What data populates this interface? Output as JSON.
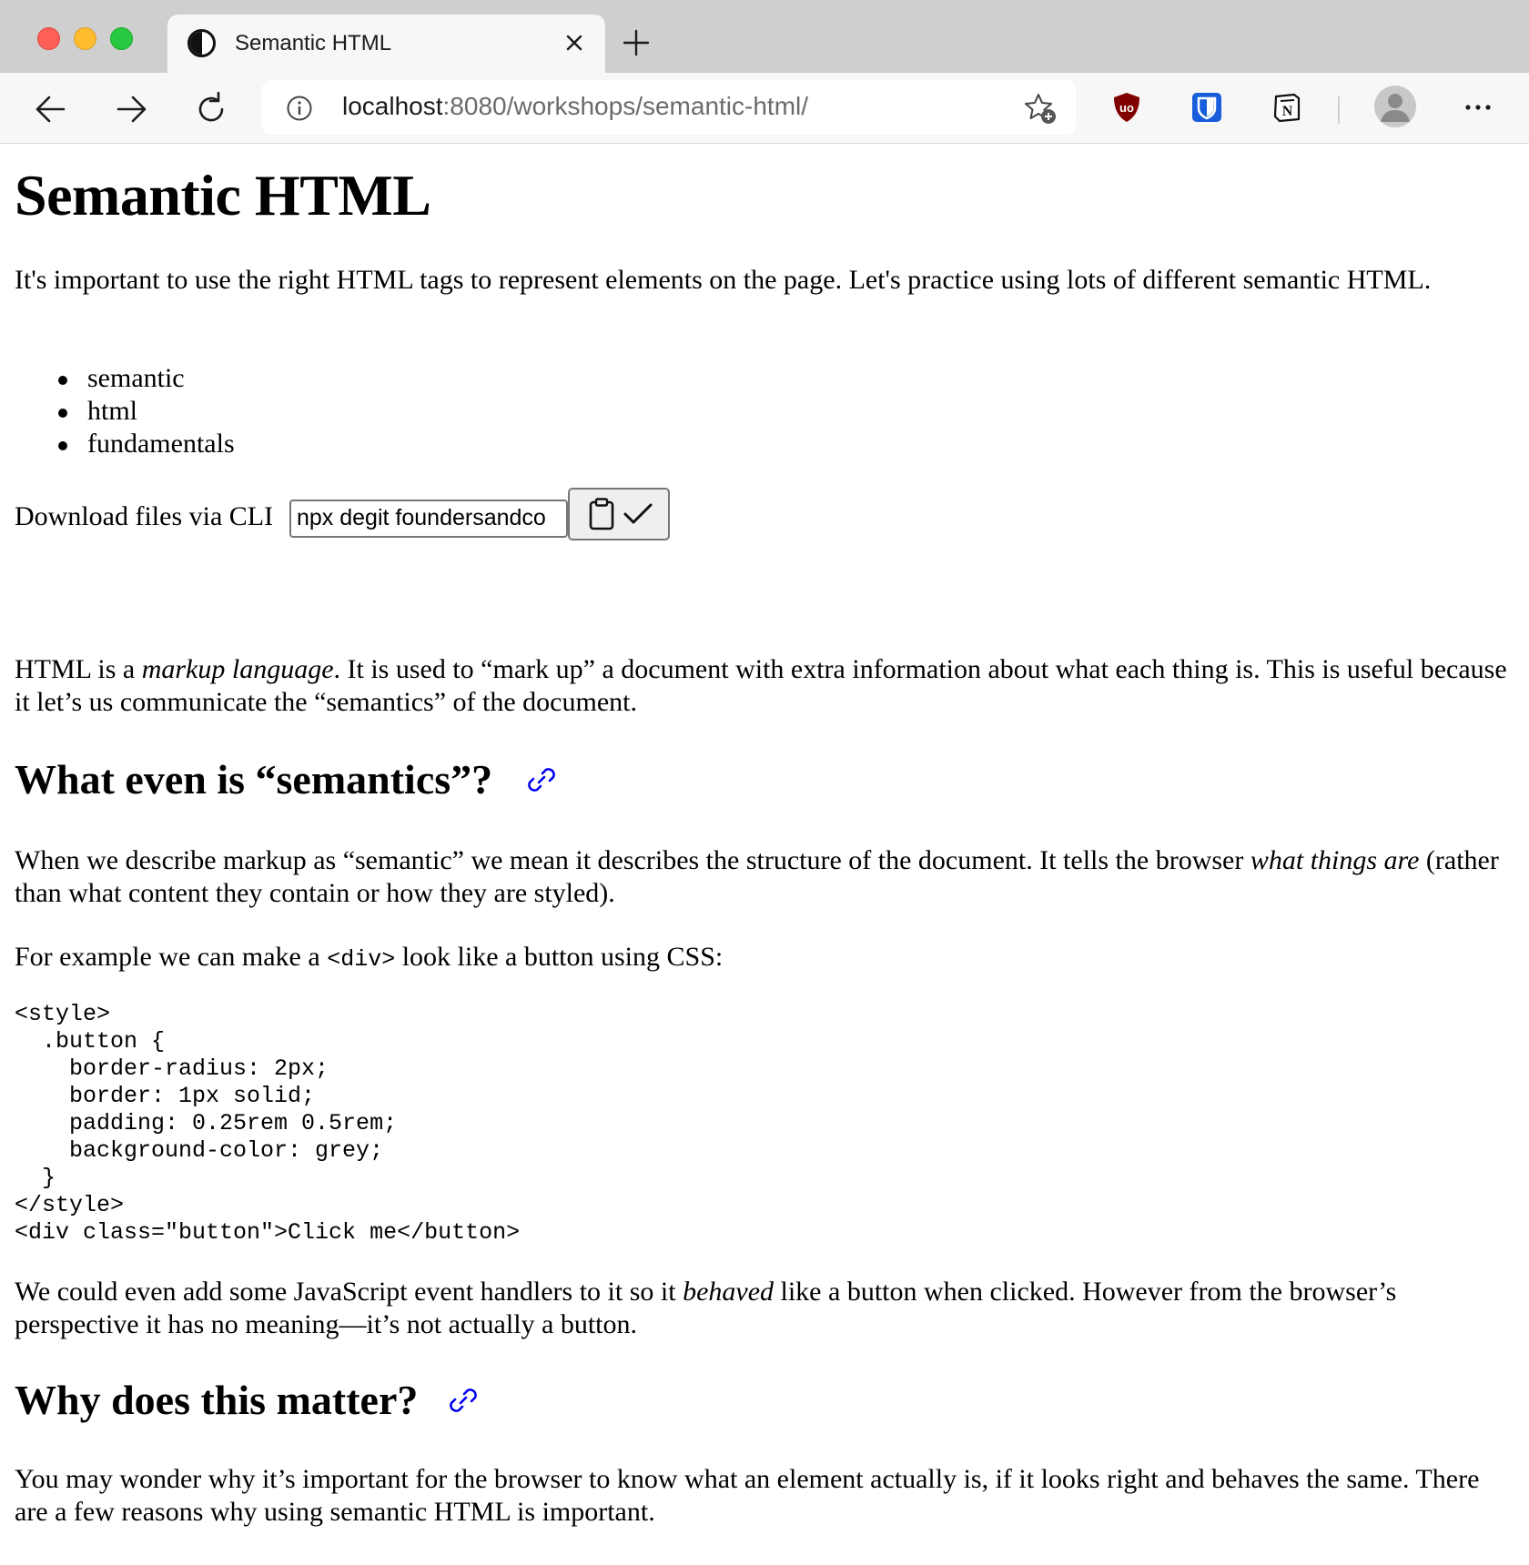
{
  "browser": {
    "tab_title": "Semantic HTML",
    "url_host": "localhost",
    "url_path": ":8080/workshops/semantic-html/"
  },
  "page": {
    "title": "Semantic HTML",
    "intro": "It's important to use the right HTML tags to represent elements on the page. Let's practice using lots of different semantic HTML.",
    "tags": [
      "semantic",
      "html",
      "fundamentals"
    ],
    "cli": {
      "label": "Download files via CLI",
      "command": "npx degit foundersandco"
    },
    "markup_paragraph": {
      "before": "HTML is a ",
      "em": "markup language",
      "after": ". It is used to “mark up” a document with extra information about what each thing is. This is useful because it let’s us communicate the “semantics” of the document."
    },
    "section1": {
      "heading": "What even is “semantics”?",
      "p1_before": "When we describe markup as “semantic” we mean it describes the structure of the document. It tells the browser ",
      "p1_em": "what things are",
      "p1_after": " (rather than what content they contain or how they are styled).",
      "p2_before": "For example we can make a ",
      "p2_code": "<div>",
      "p2_after": " look like a button using CSS:",
      "code_block": "<style>\n  .button {\n    border-radius: 2px;\n    border: 1px solid;\n    padding: 0.25rem 0.5rem;\n    background-color: grey;\n  }\n</style>\n<div class=\"button\">Click me</button>",
      "p3_before": "We could even add some JavaScript event handlers to it so it ",
      "p3_em": "behaved",
      "p3_after": " like a button when clicked. However from the browser’s perspective it has no meaning—it’s not actually a button."
    },
    "section2": {
      "heading": "Why does this matter?",
      "p1": "You may wonder why it’s important for the browser to know what an element actually is, if it looks right and behaves the same. There are a few reasons why using semantic HTML is important."
    }
  },
  "icons": {
    "tab_favicon": "half-circle-icon",
    "back": "arrow-left-icon",
    "forward": "arrow-right-icon",
    "reload": "reload-icon",
    "info": "info-icon",
    "favorites": "star-add-icon",
    "ublock": "ublock-origin-icon",
    "bitwarden": "bitwarden-icon",
    "notion": "notion-icon",
    "profile": "profile-avatar-icon",
    "more": "more-dots-icon",
    "copy": "clipboard-icon",
    "copied": "checkmark-icon",
    "anchor": "link-icon"
  },
  "colors": {
    "link_blue": "#0000ee",
    "ublock_red": "#800000",
    "bitwarden_blue": "#175ddc"
  }
}
